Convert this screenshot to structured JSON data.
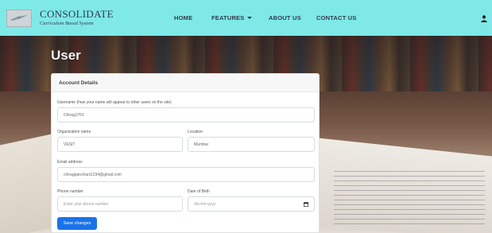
{
  "brand": {
    "name": "CONSOLIDATE",
    "subtitle": "Curriculum Based System"
  },
  "nav": {
    "home": "HOME",
    "features": "FEATURES",
    "about": "ABOUT US",
    "contact": "CONTACT US"
  },
  "page": {
    "title": "User"
  },
  "card": {
    "header": "Account Details"
  },
  "form": {
    "username_label": "Username (how your name will appear to other users on the site)",
    "username_value": "Chirag1761",
    "org_label": "Organization name",
    "org_value": "VESIT",
    "location_label": "Location",
    "location_value": "Mumbai",
    "email_label": "Email address",
    "email_value": "chiragpanchani1234@gmail.com",
    "phone_label": "Phone number",
    "phone_placeholder": "Enter your phone number",
    "dob_label": "Date of Birth",
    "dob_placeholder": "dd-mm-yyyy",
    "save_label": "Save changes"
  },
  "icons": {
    "user": "user-icon",
    "calendar": "calendar-icon",
    "logo": "logo-icon",
    "caret": "chevron-down-icon"
  },
  "colors": {
    "navbar": "#7fe9e8",
    "primary_button": "#1a73e8"
  }
}
